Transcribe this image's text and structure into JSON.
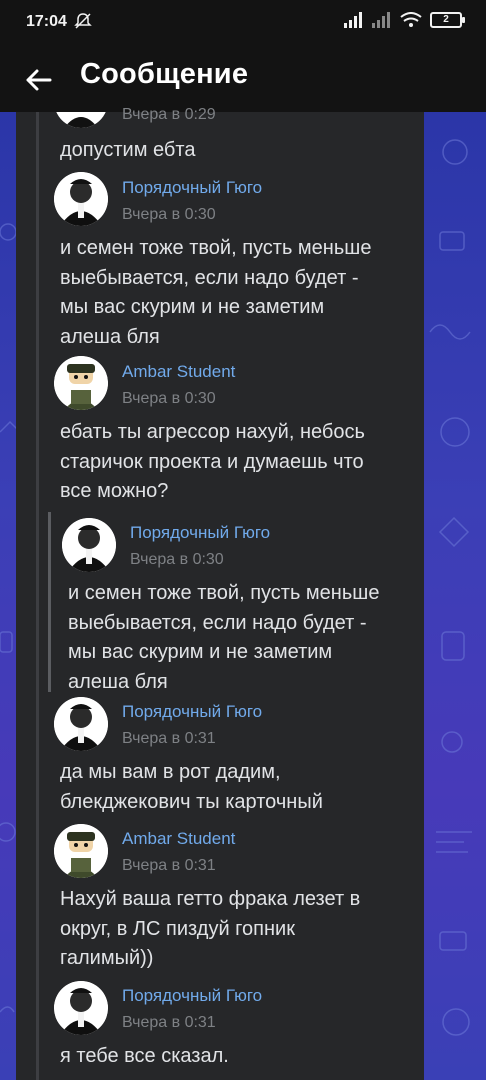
{
  "status": {
    "time": "17:04",
    "battery": "2"
  },
  "header": {
    "title": "Сообщение"
  },
  "messages": [
    {
      "id": "m0",
      "time": "Вчера в 0:29",
      "text": "допустим ебта"
    },
    {
      "id": "m1",
      "author": "Порядочный Гюго",
      "time": "Вчера в 0:30",
      "lines": [
        "и семен тоже твой, пусть меньше",
        "выебывается, если надо будет -",
        "мы вас скурим и не заметим",
        "алеша бля"
      ]
    },
    {
      "id": "m2",
      "author": "Ambar Student",
      "time": "Вчера в 0:30",
      "lines": [
        "ебать ты агрессор нахуй, небось",
        "старичок проекта и думаешь что",
        "все можно?"
      ]
    },
    {
      "id": "q1",
      "author": "Порядочный Гюго",
      "time": "Вчера в 0:30",
      "lines": [
        "и семен тоже твой, пусть меньше",
        "выебывается, если надо будет -",
        "мы вас скурим и не заметим",
        "алеша бля"
      ]
    },
    {
      "id": "m3",
      "author": "Порядочный Гюго",
      "time": "Вчера в 0:31",
      "lines": [
        "да мы вам в рот дадим,",
        "блекджекович ты карточный"
      ]
    },
    {
      "id": "m4",
      "author": "Ambar Student",
      "time": "Вчера в 0:31",
      "lines": [
        "Нахуй ваша гетто фрака лезет в",
        "округ, в ЛС пиздуй гопник",
        "галимый))"
      ]
    },
    {
      "id": "m5",
      "author": "Порядочный Гюго",
      "time": "Вчера в 0:31",
      "lines": [
        "я тебе все сказал."
      ]
    }
  ],
  "colors": {
    "author": "#71aaeb",
    "time": "#7e8185",
    "text": "#e1e3e6",
    "card": "#262729",
    "bg": "#3b3fb6"
  },
  "icons": {
    "back": "arrow-left-icon",
    "muted": "bell-off-icon",
    "signal": "signal-icon",
    "wifi": "wifi-icon",
    "battery": "battery-icon"
  }
}
